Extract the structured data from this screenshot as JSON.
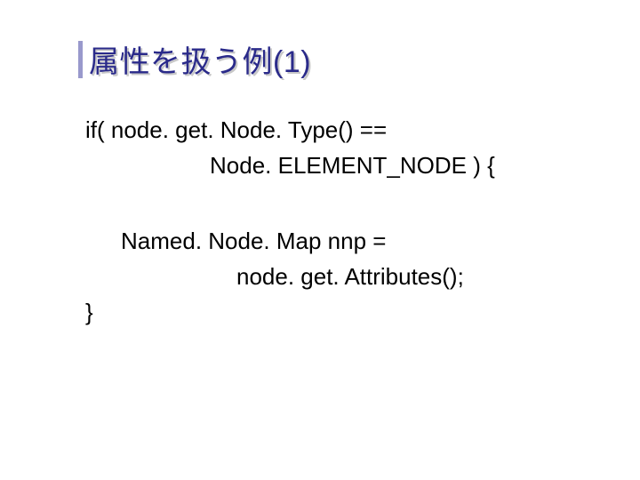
{
  "title": "属性を扱う例(1)",
  "code": {
    "l1": "if( node. get. Node. Type() ==",
    "l2": "Node. ELEMENT_NODE ) {",
    "l3": "Named. Node. Map nnp =",
    "l4": "node. get. Attributes();",
    "l5": "}"
  }
}
